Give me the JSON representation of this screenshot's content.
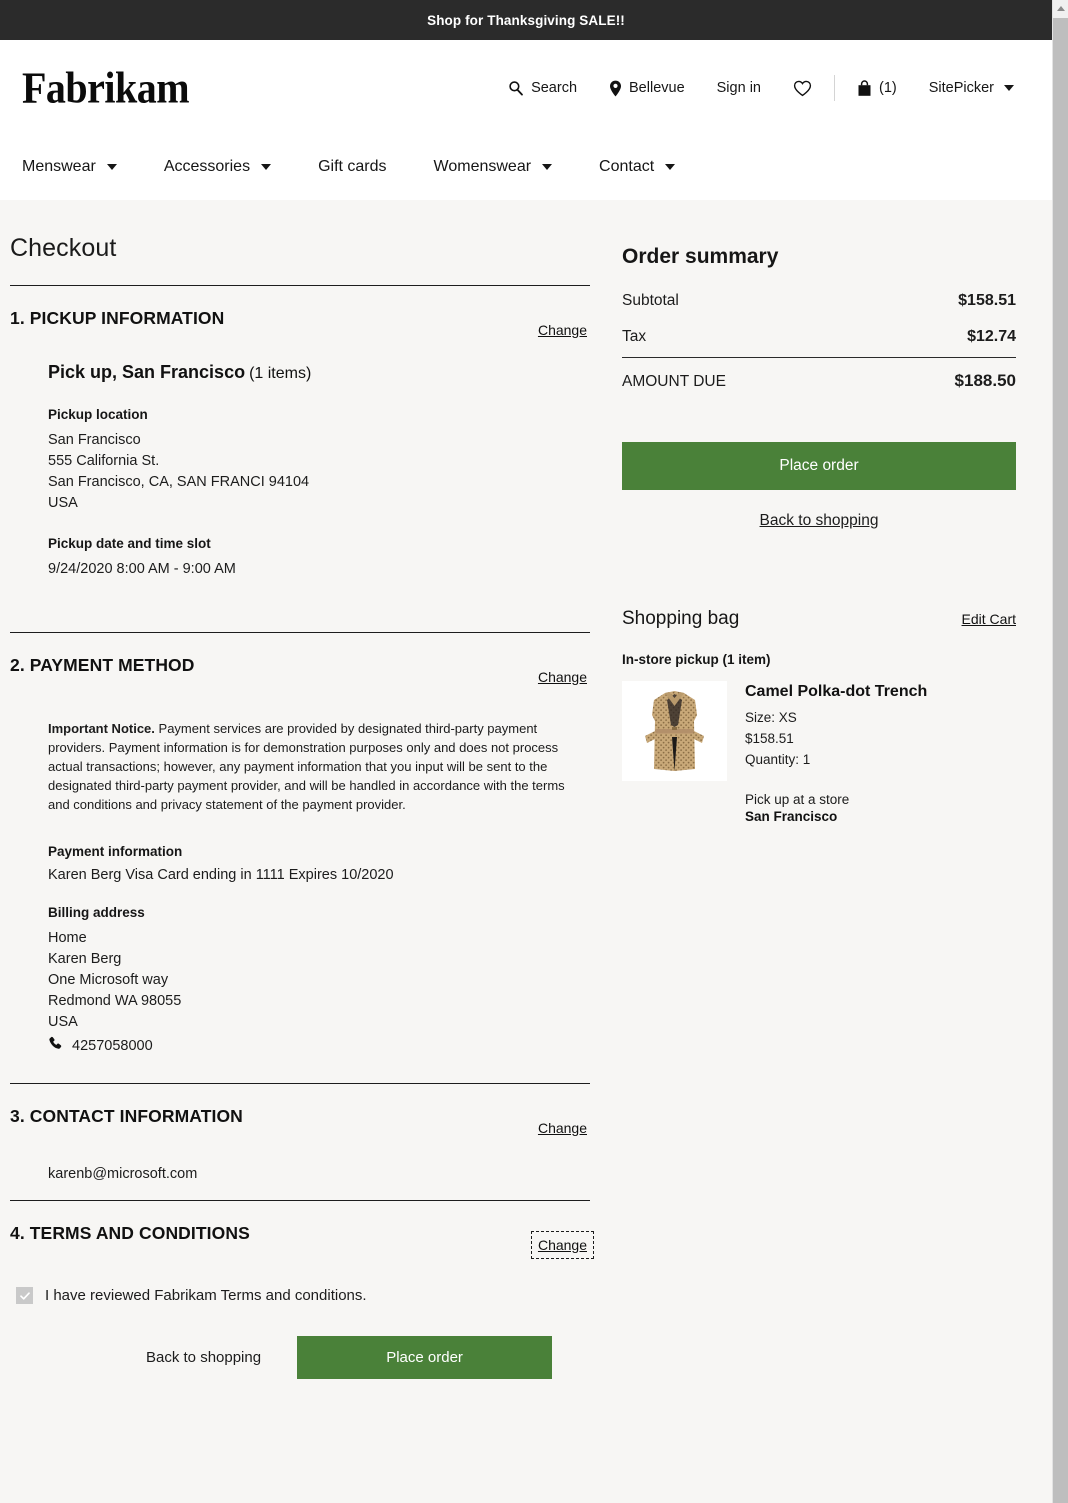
{
  "promo": {
    "text": "Shop for Thanksgiving SALE!!"
  },
  "header": {
    "logo": "Fabrikam",
    "actions": {
      "search": "Search",
      "location": "Bellevue",
      "signin": "Sign in",
      "bag_count": "(1)",
      "sitepicker": "SitePicker"
    },
    "nav": [
      {
        "label": "Menswear",
        "has_chevron": true
      },
      {
        "label": "Accessories",
        "has_chevron": true
      },
      {
        "label": "Gift cards",
        "has_chevron": false
      },
      {
        "label": "Womenswear",
        "has_chevron": true
      },
      {
        "label": "Contact",
        "has_chevron": true
      }
    ]
  },
  "page": {
    "title": "Checkout"
  },
  "sections": {
    "pickup": {
      "number_title": "1. PICKUP INFORMATION",
      "change": "Change",
      "mode_title": "Pick up, San Francisco",
      "mode_count": "(1 items)",
      "location_label": "Pickup location",
      "location_lines": [
        "San Francisco",
        "555 California St.",
        "San Francisco, CA, SAN FRANCI 94104",
        "USA"
      ],
      "slot_label": "Pickup date and time slot",
      "slot_value": "9/24/2020 8:00 AM - 9:00 AM"
    },
    "payment": {
      "number_title": "2. PAYMENT METHOD",
      "change": "Change",
      "notice_label": "Important Notice.",
      "notice_body": "Payment services are provided by designated third-party payment providers.  Payment information is for demonstration purposes only and does not process actual transactions; however, any payment information that you input will be sent to the designated third-party payment provider, and will be handled in accordance with the terms and conditions and privacy statement of the payment provider.",
      "payment_info_label": "Payment information",
      "payment_info_value": "Karen Berg   Visa   Card ending in 1111   Expires 10/2020",
      "billing_label": "Billing address",
      "billing_lines": [
        "Home",
        "Karen Berg",
        "One Microsoft way",
        "Redmond WA  98055",
        "USA"
      ],
      "phone": "4257058000"
    },
    "contact": {
      "number_title": "3. CONTACT INFORMATION",
      "change": "Change",
      "email": "karenb@microsoft.com"
    },
    "terms": {
      "number_title": "4. TERMS AND CONDITIONS",
      "change": "Change",
      "change_focused": true,
      "checkbox_checked": true,
      "checkbox_label": "I have reviewed Fabrikam Terms and conditions."
    }
  },
  "bottom_actions": {
    "back_to_shopping": "Back to shopping",
    "place_order": "Place order"
  },
  "order_summary": {
    "title": "Order summary",
    "rows": [
      {
        "label": "Subtotal",
        "value": "$158.51"
      },
      {
        "label": "Tax",
        "value": "$12.74"
      }
    ],
    "total": {
      "label": "AMOUNT DUE",
      "value": "$188.50"
    },
    "place_order": "Place order",
    "back_to_shopping": "Back to shopping"
  },
  "shopping_bag": {
    "title": "Shopping bag",
    "edit_cart": "Edit Cart",
    "subhead": "In-store pickup (1 item)",
    "item": {
      "name": "Camel Polka-dot Trench",
      "size": "Size: XS",
      "price": "$158.51",
      "quantity": "Quantity: 1",
      "pickup_note": "Pick up at a store",
      "pickup_store": "San Francisco"
    }
  },
  "colors": {
    "accent_green": "#4a8139",
    "banner_bg": "#2b2b2b",
    "page_bg": "#f7f6f4"
  }
}
